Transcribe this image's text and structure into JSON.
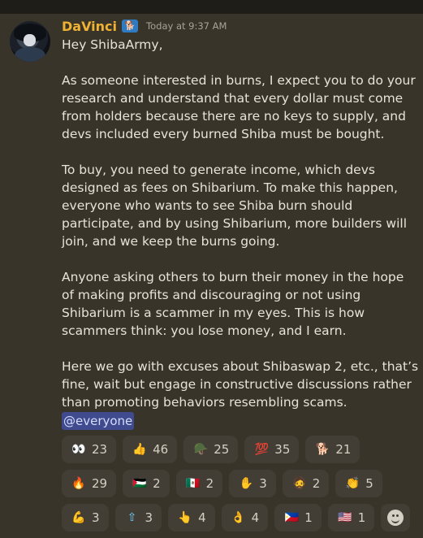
{
  "message": {
    "username": "DaVinci",
    "user_badge": "🐕",
    "timestamp": "Today at 9:37 AM",
    "paragraphs": [
      "Hey ShibaArmy,",
      "As someone interested in burns, I expect you to do your research and understand that every dollar must come from holders because there are no keys to supply, and devs included every burned Shiba must be bought.",
      "To buy, you need to generate income, which devs designed as fees on Shibarium. To make this happen, everyone who wants to see Shiba burn should participate, and by using Shibarium, more builders will join, and we keep the burns going.",
      "Anyone asking others to burn their money in the hope of making profits and discouraging or not using Shibarium is a scammer in my eyes. This is how scammers think: you lose money, and I earn.",
      "Here we go with excuses about Shibaswap 2, etc., that’s fine, wait but engage in constructive discussions rather than promoting behaviors resembling scams."
    ],
    "mention": "@everyone"
  },
  "reactions": [
    {
      "icon": "eyes-icon",
      "glyph": "👀",
      "count": "23"
    },
    {
      "icon": "thumbs-up-icon",
      "glyph": "👍",
      "count": "46"
    },
    {
      "icon": "soldier-icon",
      "glyph": "🪖",
      "count": "25"
    },
    {
      "icon": "hundred-icon",
      "glyph": "💯",
      "count": "35"
    },
    {
      "icon": "shiba-money-icon",
      "glyph": "🐕",
      "count": "21"
    },
    {
      "icon": "fire-icon",
      "glyph": "🔥",
      "count": "29"
    },
    {
      "icon": "palestine-flag-icon",
      "glyph": "🇵🇸",
      "count": "2"
    },
    {
      "icon": "mexico-flag-icon",
      "glyph": "🇲🇽",
      "count": "2"
    },
    {
      "icon": "raised-hand-icon",
      "glyph": "✋",
      "count": "3"
    },
    {
      "icon": "face-icon",
      "glyph": "🧔",
      "count": "2"
    },
    {
      "icon": "clapping-icon",
      "glyph": "👏",
      "count": "5"
    },
    {
      "icon": "muscle-icon",
      "glyph": "💪",
      "count": "3"
    },
    {
      "icon": "this-arrow-icon",
      "glyph": "⇧",
      "count": "3"
    },
    {
      "icon": "point-up-icon",
      "glyph": "👆",
      "count": "4"
    },
    {
      "icon": "ok-hand-icon",
      "glyph": "👌",
      "count": "4"
    },
    {
      "icon": "philippines-flag-icon",
      "glyph": "🇵🇭",
      "count": "1"
    },
    {
      "icon": "us-flag-icon",
      "glyph": "🇺🇸",
      "count": "1"
    }
  ],
  "colors": {
    "background": "#38342a",
    "username": "#f0b232",
    "mention_bg": "#3f4a8f",
    "reaction_bg": "#423e35"
  }
}
